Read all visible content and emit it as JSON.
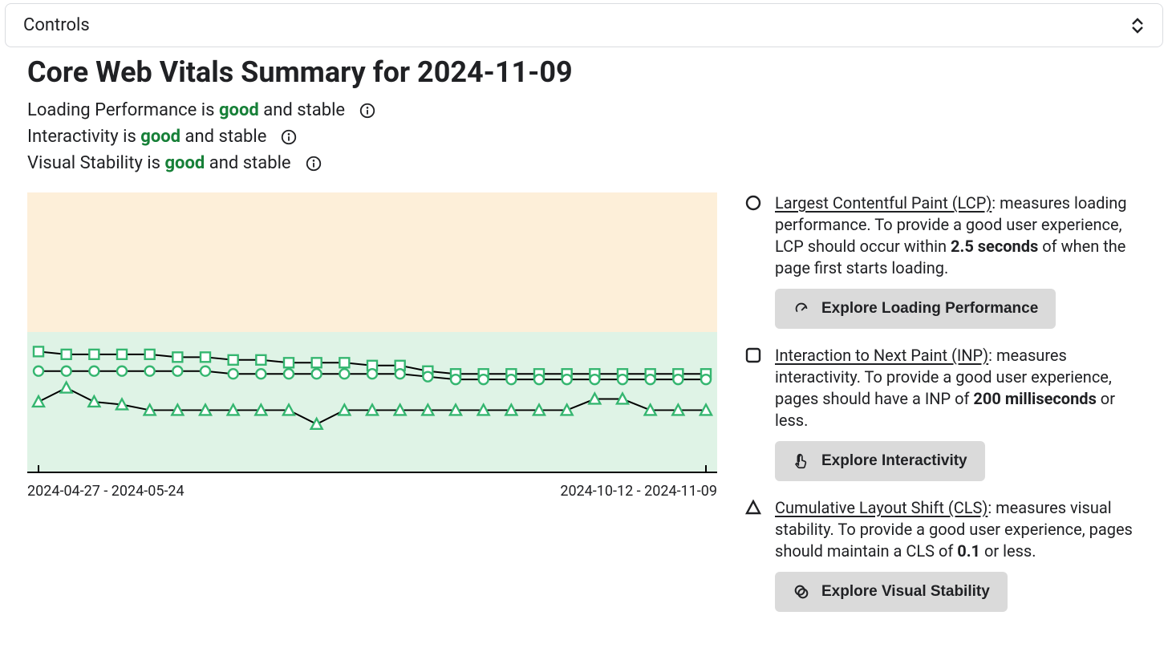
{
  "controls": {
    "label": "Controls"
  },
  "header": {
    "title": "Core Web Vitals Summary for 2024-11-09",
    "lines": [
      {
        "metric": "Loading Performance",
        "status": "good",
        "trend": "and stable"
      },
      {
        "metric": "Interactivity",
        "status": "good",
        "trend": "and stable"
      },
      {
        "metric": "Visual Stability",
        "status": "good",
        "trend": "and stable"
      }
    ]
  },
  "chart_data": {
    "type": "line",
    "x_start_label": "2024-04-27 - 2024-05-24",
    "x_end_label": "2024-10-12 - 2024-11-09",
    "y_range": [
      0,
      100
    ],
    "good_threshold_pct": 50,
    "points": 25,
    "series": [
      {
        "name": "LCP",
        "marker": "square",
        "color": "#35b670",
        "values": [
          43,
          42,
          42,
          42,
          42,
          41,
          41,
          40,
          40,
          39,
          39,
          39,
          38,
          38,
          36,
          35,
          35,
          35,
          35,
          35,
          35,
          35,
          35,
          35,
          35
        ]
      },
      {
        "name": "INP",
        "marker": "circle",
        "color": "#35b670",
        "values": [
          36,
          36,
          36,
          36,
          36,
          36,
          36,
          35,
          35,
          35,
          35,
          35,
          35,
          35,
          34,
          33,
          33,
          33,
          33,
          33,
          33,
          33,
          33,
          33,
          33
        ]
      },
      {
        "name": "CLS",
        "marker": "triangle",
        "color": "#35b670",
        "values": [
          25,
          30,
          25,
          24,
          22,
          22,
          22,
          22,
          22,
          22,
          17,
          22,
          22,
          22,
          22,
          22,
          22,
          22,
          22,
          22,
          26,
          26,
          22,
          22,
          22
        ]
      }
    ]
  },
  "legend": {
    "lcp": {
      "term": "Largest Contentful Paint (LCP)",
      "desc1": ": measures loading performance. To provide a good user experience, LCP should occur within ",
      "bold": "2.5 seconds",
      "desc2": " of when the page first starts loading.",
      "button": "Explore Loading Performance"
    },
    "inp": {
      "term": "Interaction to Next Paint (INP)",
      "desc1": ": measures interactivity. To provide a good user experience, pages should have a INP of ",
      "bold": "200 milliseconds",
      "desc2": " or less.",
      "button": "Explore Interactivity"
    },
    "cls": {
      "term": "Cumulative Layout Shift (CLS)",
      "desc1": ": measures visual stability. To provide a good user experience, pages should maintain a CLS of ",
      "bold": "0.1",
      "desc2": " or less.",
      "button": "Explore Visual Stability"
    }
  }
}
